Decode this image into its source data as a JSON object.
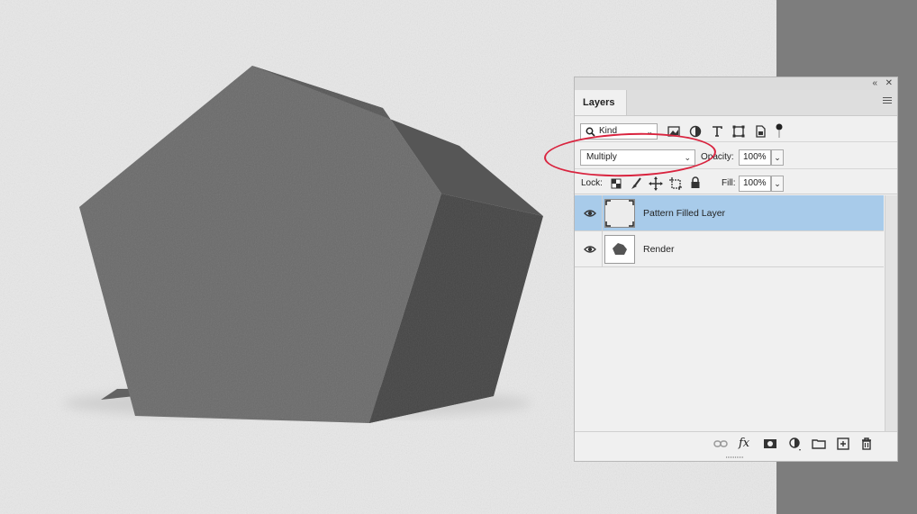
{
  "panel": {
    "collapse_icon": "double-chevron-left-icon",
    "close_icon": "close-icon",
    "tab_label": "Layers",
    "menu_icon": "hamburger-menu-icon"
  },
  "filter": {
    "kind_label": "Kind",
    "icons": [
      "image-filter-icon",
      "adjustment-filter-icon",
      "type-filter-icon",
      "shape-filter-icon",
      "smart-object-filter-icon"
    ]
  },
  "blend": {
    "mode": "Multiply",
    "opacity_label": "Opacity:",
    "opacity_value": "100%"
  },
  "lock": {
    "label": "Lock:",
    "fill_label": "Fill:",
    "fill_value": "100%"
  },
  "layers": [
    {
      "name": "Pattern Filled Layer",
      "selected": true,
      "visible": true
    },
    {
      "name": "Render",
      "selected": false,
      "visible": true
    }
  ],
  "footer_icons": [
    "link-icon",
    "fx-icon",
    "mask-icon",
    "adjustment-layer-icon",
    "folder-icon",
    "new-layer-icon",
    "trash-icon"
  ],
  "footer": {
    "fx": "fx"
  },
  "colors": {
    "selection": "#a8cbea",
    "highlight_ring": "#d9243f"
  }
}
